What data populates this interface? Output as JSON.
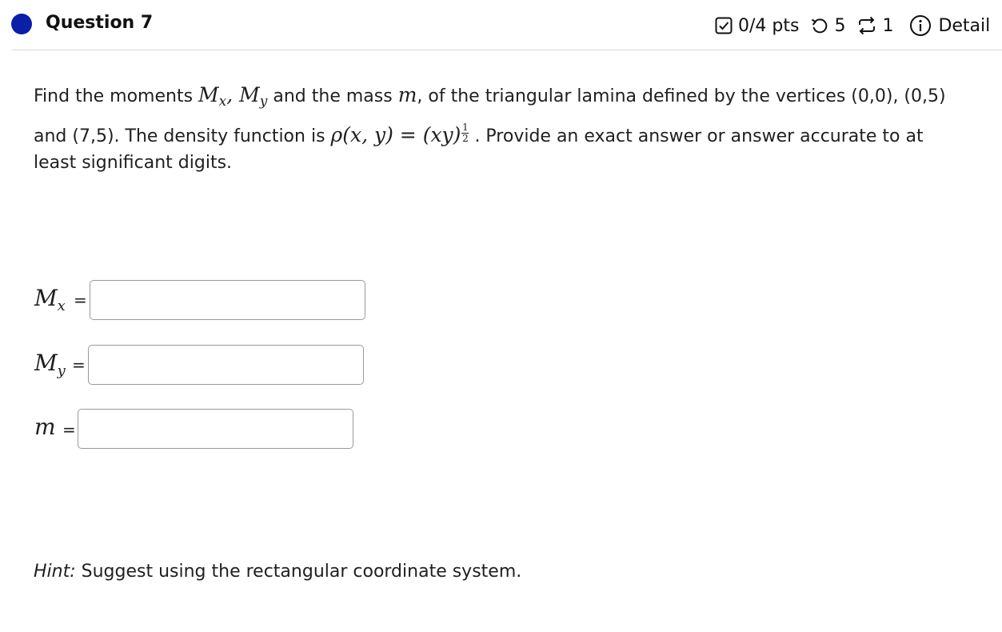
{
  "header": {
    "question_title": "Question 7",
    "points": "0/4 pts",
    "attempts_count": "5",
    "retries_count": "1",
    "details_label": "Detail",
    "status_color": "#0a1fa8",
    "icons": [
      "status-dot-icon",
      "checkbox-icon",
      "undo-icon",
      "retry-icon",
      "info-icon"
    ]
  },
  "question": {
    "text_part1": "Find the moments ",
    "text_part2": " and the mass ",
    "text_part3": ", of the triangular lamina defined by the vertices (0,0), (0,5)",
    "text_part4": "and (7,5). The density function is ",
    "text_part5": ". Provide an exact answer or answer accurate to at",
    "text_part6": "least significant digits.",
    "mx_symbol": "M",
    "mx_sub": "x",
    "my_symbol": "M",
    "my_sub": "y",
    "mass_symbol": "m",
    "density_lhs": "ρ(x, y)",
    "density_eq": " = ",
    "density_rhs": "(xy)",
    "exp_num": "1",
    "exp_den": "2"
  },
  "answers": [
    {
      "symbol": "M",
      "sub": "x",
      "equals": "=",
      "value": ""
    },
    {
      "symbol": "M",
      "sub": "y",
      "equals": "=",
      "value": ""
    },
    {
      "symbol": "m",
      "sub": "",
      "equals": "=",
      "value": ""
    }
  ],
  "hint": {
    "label": "Hint:",
    "text": " Suggest using the rectangular coordinate system."
  }
}
